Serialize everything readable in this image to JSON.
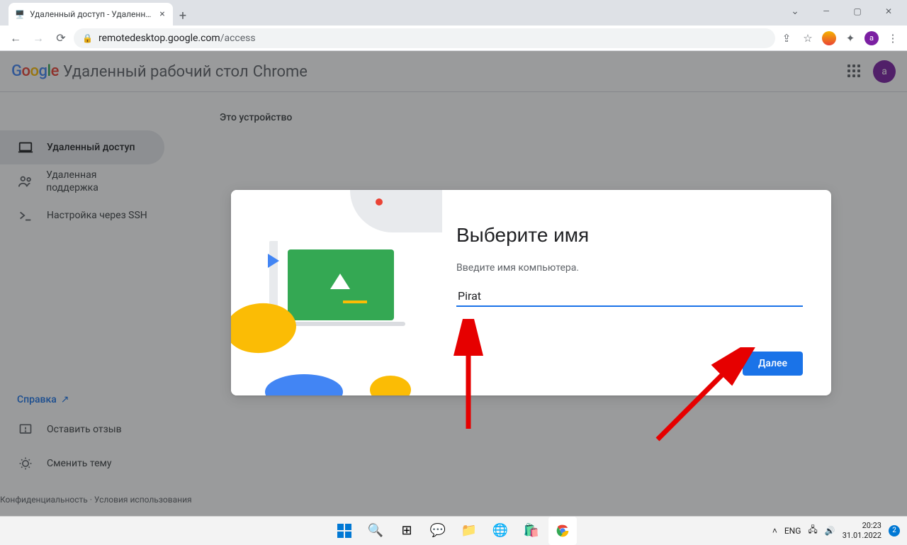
{
  "browser": {
    "tab_title": "Удаленный доступ - Удаленный",
    "url_host": "remotedesktop.google.com",
    "url_path": "/access"
  },
  "header": {
    "product": "Удаленный рабочий стол",
    "chrome": "Chrome",
    "avatar_letter": "a"
  },
  "sidebar": {
    "items": [
      {
        "label": "Удаленный доступ",
        "icon": "laptop"
      },
      {
        "label": "Удаленная поддержка",
        "icon": "group"
      },
      {
        "label": "Настройка через SSH",
        "icon": "terminal"
      }
    ],
    "help": "Справка",
    "feedback": "Оставить отзыв",
    "theme": "Сменить тему",
    "privacy": "Конфиденциальность",
    "terms": "Условия использования"
  },
  "main": {
    "section": "Это устройство"
  },
  "dialog": {
    "title": "Выберите имя",
    "subtitle": "Введите имя компьютера.",
    "value": "Pirat",
    "next": "Далее"
  },
  "taskbar": {
    "lang": "ENG",
    "time": "20:23",
    "date": "31.01.2022",
    "notif_count": "2"
  }
}
